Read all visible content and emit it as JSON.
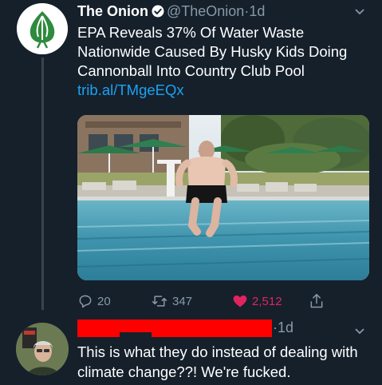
{
  "tweet": {
    "author_name": "The Onion",
    "handle": "@TheOnion",
    "separator": "·",
    "time": "1d",
    "text": "EPA Reveals 37% Of Water Waste Nationwide Caused By Husky Kids Doing Cannonball Into Country Club Pool",
    "link": "trib.al/TMgeEQx",
    "stats": {
      "replies": "20",
      "retweets": "347",
      "likes": "2,512"
    },
    "icons": [
      "onion-logo",
      "verified-badge-icon",
      "chevron-down-icon",
      "reply-icon",
      "retweet-icon",
      "heart-icon",
      "share-icon"
    ]
  },
  "reply": {
    "separator": "·",
    "time": "1d",
    "text": "This is what they do instead of dealing with climate change??! We're fucked."
  },
  "colors": {
    "background": "#15202b",
    "text": "#ffffff",
    "muted": "#8899a6",
    "link": "#1da1f2",
    "like": "#e0245e",
    "redaction": "#ff0000",
    "onion_green": "#2f8a3e"
  }
}
